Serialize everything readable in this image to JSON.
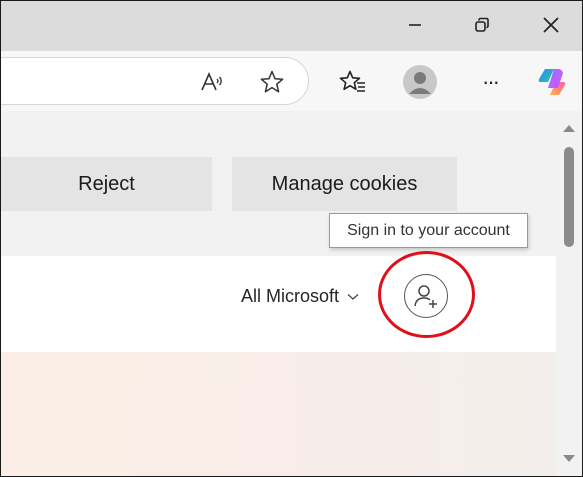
{
  "window_controls": {
    "minimize_icon": "minimize-icon",
    "restore_icon": "restore-icon",
    "close_icon": "close-icon"
  },
  "toolbar": {
    "read_aloud_icon": "read-aloud-icon",
    "favorite_icon": "star-icon",
    "favorites_list_icon": "favorites-icon",
    "profile_icon": "profile-avatar-icon",
    "more_label": "···",
    "copilot_icon": "copilot-icon"
  },
  "cookie_banner": {
    "reject_label": "Reject",
    "manage_label": "Manage cookies"
  },
  "tooltip": {
    "text": "Sign in to your account"
  },
  "header": {
    "all_microsoft_label": "All Microsoft",
    "signin_icon": "person-add-icon"
  },
  "colors": {
    "highlight_ring": "#e0101a",
    "titlebar": "#dcdcdc",
    "cookie_button": "#e4e4e4",
    "hero_gradient_start": "#fbeee6"
  }
}
